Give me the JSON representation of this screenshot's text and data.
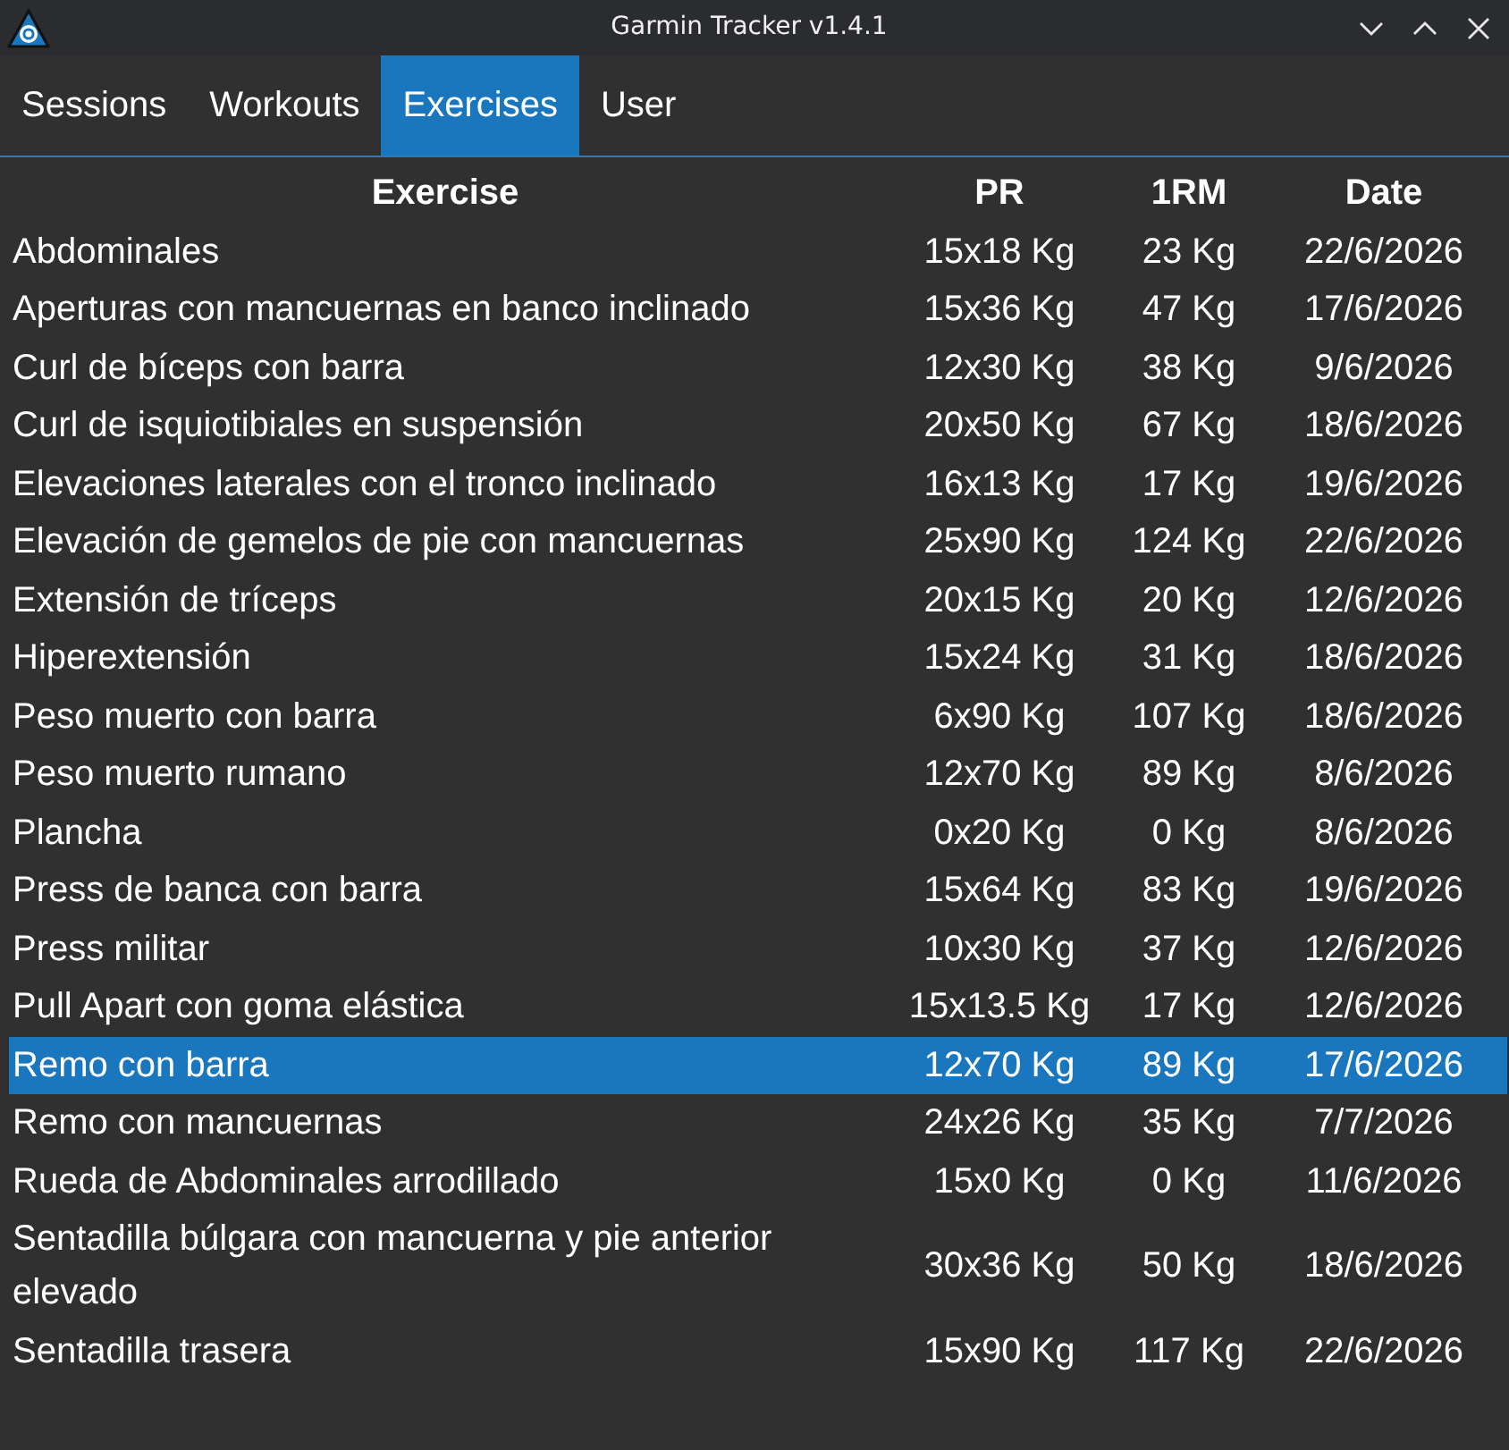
{
  "window": {
    "title": "Garmin Tracker v1.4.1"
  },
  "tabs": [
    {
      "label": "Sessions",
      "selected": false
    },
    {
      "label": "Workouts",
      "selected": false
    },
    {
      "label": "Exercises",
      "selected": true
    },
    {
      "label": "User",
      "selected": false
    }
  ],
  "table": {
    "columns": [
      "Exercise",
      "PR",
      "1RM",
      "Date"
    ],
    "rows": [
      {
        "cells": [
          "Abdominales",
          "15x18 Kg",
          "23 Kg",
          "22/6/2026"
        ],
        "selected": false
      },
      {
        "cells": [
          "Aperturas con mancuernas en banco inclinado",
          "15x36 Kg",
          "47 Kg",
          "17/6/2026"
        ],
        "selected": false
      },
      {
        "cells": [
          "Curl de bíceps con barra",
          "12x30 Kg",
          "38 Kg",
          "9/6/2026"
        ],
        "selected": false
      },
      {
        "cells": [
          "Curl de isquiotibiales en suspensión",
          "20x50 Kg",
          "67 Kg",
          "18/6/2026"
        ],
        "selected": false
      },
      {
        "cells": [
          "Elevaciones laterales con el tronco inclinado",
          "16x13 Kg",
          "17 Kg",
          "19/6/2026"
        ],
        "selected": false
      },
      {
        "cells": [
          "Elevación de gemelos de pie con mancuernas",
          "25x90 Kg",
          "124 Kg",
          "22/6/2026"
        ],
        "selected": false
      },
      {
        "cells": [
          "Extensión de tríceps",
          "20x15 Kg",
          "20 Kg",
          "12/6/2026"
        ],
        "selected": false
      },
      {
        "cells": [
          "Hiperextensión",
          "15x24 Kg",
          "31 Kg",
          "18/6/2026"
        ],
        "selected": false
      },
      {
        "cells": [
          "Peso muerto con barra",
          "6x90 Kg",
          "107 Kg",
          "18/6/2026"
        ],
        "selected": false
      },
      {
        "cells": [
          "Peso muerto rumano",
          "12x70 Kg",
          "89 Kg",
          "8/6/2026"
        ],
        "selected": false
      },
      {
        "cells": [
          "Plancha",
          "0x20 Kg",
          "0 Kg",
          "8/6/2026"
        ],
        "selected": false
      },
      {
        "cells": [
          "Press de banca con barra",
          "15x64 Kg",
          "83 Kg",
          "19/6/2026"
        ],
        "selected": false
      },
      {
        "cells": [
          "Press militar",
          "10x30 Kg",
          "37 Kg",
          "12/6/2026"
        ],
        "selected": false
      },
      {
        "cells": [
          "Pull Apart con goma elástica",
          "15x13.5 Kg",
          "17 Kg",
          "12/6/2026"
        ],
        "selected": false
      },
      {
        "cells": [
          "Remo con barra",
          "12x70 Kg",
          "89 Kg",
          "17/6/2026"
        ],
        "selected": true
      },
      {
        "cells": [
          "Remo con mancuernas",
          "24x26 Kg",
          "35 Kg",
          "7/7/2026"
        ],
        "selected": false
      },
      {
        "cells": [
          "Rueda de Abdominales arrodillado",
          "15x0 Kg",
          "0 Kg",
          "11/6/2026"
        ],
        "selected": false
      },
      {
        "cells": [
          "Sentadilla búlgara con mancuerna y pie anterior elevado",
          "30x36 Kg",
          "50 Kg",
          "18/6/2026"
        ],
        "selected": false
      },
      {
        "cells": [
          "Sentadilla trasera",
          "15x90 Kg",
          "117 Kg",
          "22/6/2026"
        ],
        "selected": false
      }
    ]
  }
}
